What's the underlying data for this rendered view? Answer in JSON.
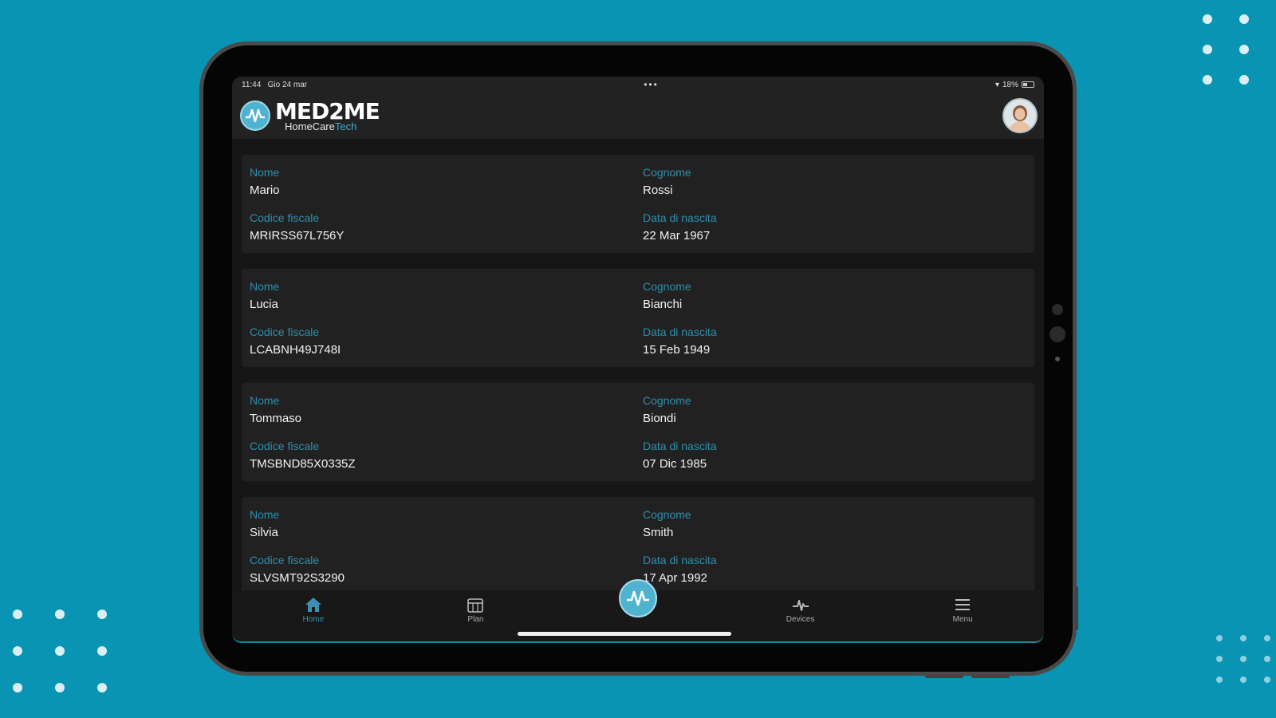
{
  "status_bar": {
    "time": "11:44",
    "date": "Gio 24 mar",
    "battery": "18%"
  },
  "brand": {
    "name": "MED2ME",
    "sub_a": "HomeCare",
    "sub_b": "Tech"
  },
  "labels": {
    "nome": "Nome",
    "cognome": "Cognome",
    "codice_fiscale": "Codice fiscale",
    "data_nascita": "Data di nascita"
  },
  "patients": [
    {
      "nome": "Mario",
      "cognome": "Rossi",
      "codice_fiscale": "MRIRSS67L756Y",
      "data_nascita": "22 Mar 1967"
    },
    {
      "nome": "Lucia",
      "cognome": "Bianchi",
      "codice_fiscale": "LCABNH49J748I",
      "data_nascita": "15 Feb 1949"
    },
    {
      "nome": "Tommaso",
      "cognome": "Biondi",
      "codice_fiscale": "TMSBND85X0335Z",
      "data_nascita": "07 Dic 1985"
    },
    {
      "nome": "Silvia",
      "cognome": "Smith",
      "codice_fiscale": "SLVSMT92S3290",
      "data_nascita": "17 Apr 1992"
    }
  ],
  "tabs": [
    {
      "label": "Home",
      "icon": "home-icon"
    },
    {
      "label": "Plan",
      "icon": "calendar-icon"
    },
    {
      "label": "",
      "icon": "med2me-logo-icon"
    },
    {
      "label": "Devices",
      "icon": "pulse-icon"
    },
    {
      "label": "Menu",
      "icon": "menu-icon"
    }
  ],
  "colors": {
    "background": "#0a94b3",
    "accent": "#2f8fae",
    "card": "#212121"
  }
}
